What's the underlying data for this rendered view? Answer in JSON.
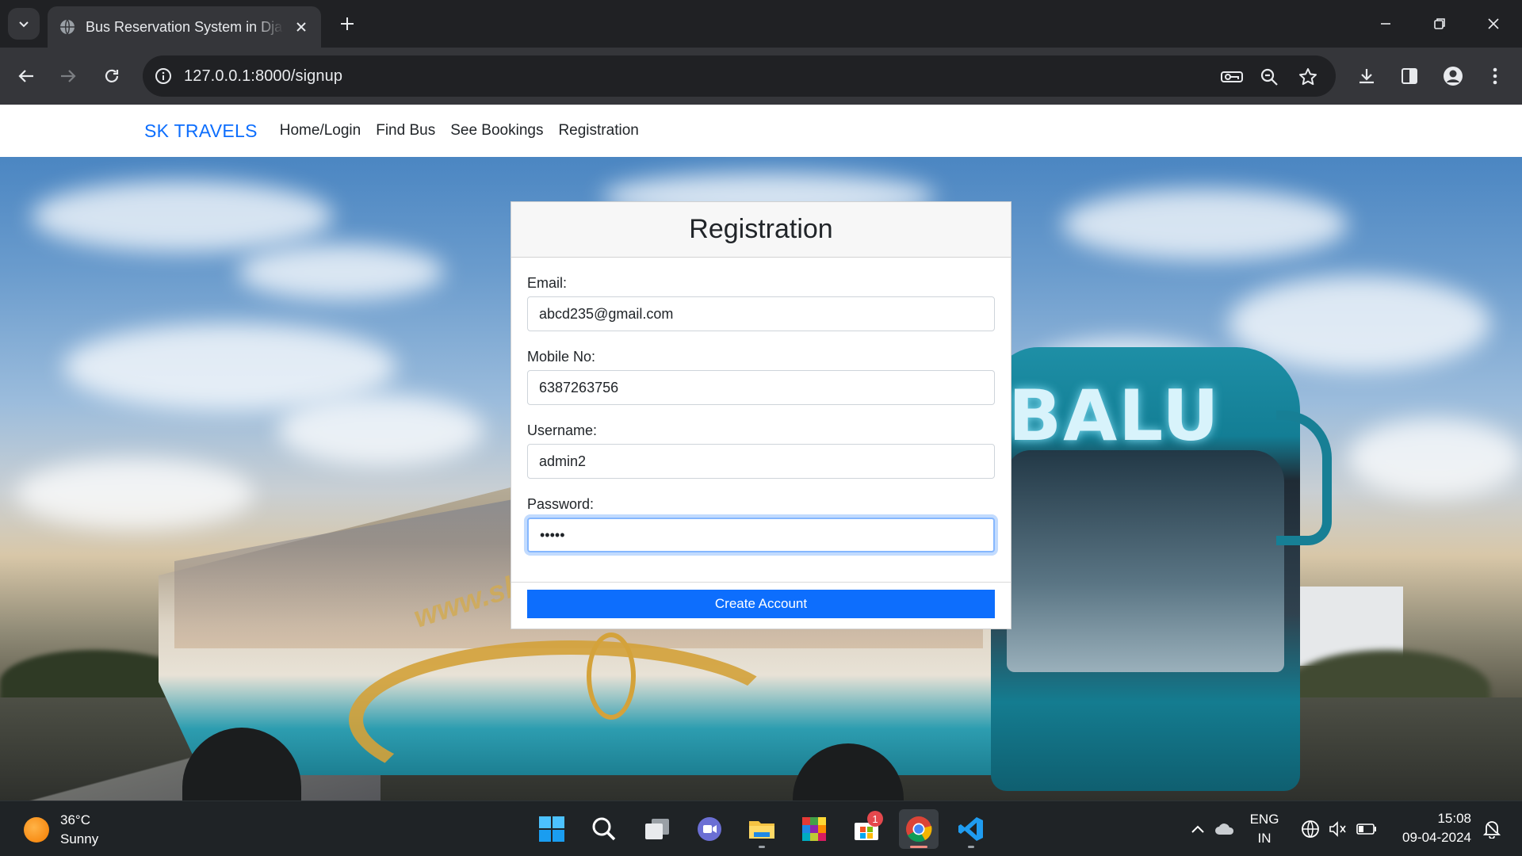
{
  "browser": {
    "tab_title": "Bus Reservation System in Django",
    "url": "127.0.0.1:8000/signup"
  },
  "navbar": {
    "brand": "SK TRAVELS",
    "links": [
      "Home/Login",
      "Find Bus",
      "See Bookings",
      "Registration"
    ]
  },
  "hero": {
    "bus_name": "BALU",
    "bus_website": "www.sk"
  },
  "form": {
    "title": "Registration",
    "fields": [
      {
        "label": "Email:",
        "value": "abcd235@gmail.com"
      },
      {
        "label": "Mobile No:",
        "value": "6387263756"
      },
      {
        "label": "Username:",
        "value": "admin2"
      },
      {
        "label": "Password:",
        "value": "•••••"
      }
    ],
    "submit_label": "Create Account"
  },
  "taskbar": {
    "weather_temp": "36°C",
    "weather_desc": "Sunny",
    "store_badge": "1",
    "language_line1": "ENG",
    "language_line2": "IN",
    "time": "15:08",
    "date": "09-04-2024"
  },
  "colors": {
    "brand": "#0d6efd",
    "primary_button": "#0d6efd",
    "chrome_dark": "#202124",
    "chrome_toolbar": "#35363a"
  }
}
